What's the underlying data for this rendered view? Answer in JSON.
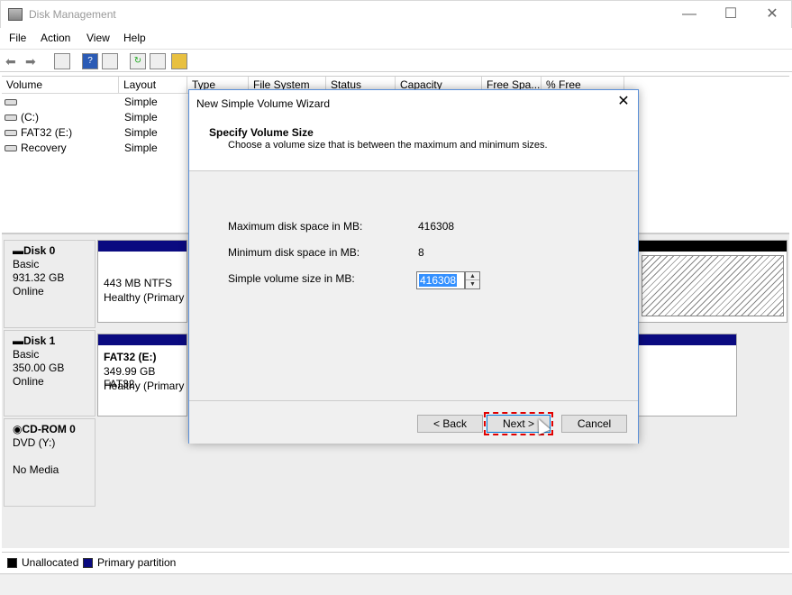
{
  "window": {
    "title": "Disk Management",
    "minimize": "—",
    "maximize": "☐",
    "close": "✕"
  },
  "menu": [
    "File",
    "Action",
    "View",
    "Help"
  ],
  "volume_list": {
    "columns": [
      "Volume",
      "Layout",
      "Type",
      "File System",
      "Status",
      "Capacity",
      "Free Spa...",
      "% Free"
    ],
    "rows": [
      {
        "volume": "",
        "layout": "Simple"
      },
      {
        "volume": "(C:)",
        "layout": "Simple"
      },
      {
        "volume": "FAT32 (E:)",
        "layout": "Simple"
      },
      {
        "volume": "Recovery",
        "layout": "Simple"
      }
    ]
  },
  "disks": [
    {
      "name": "Disk 0",
      "type": "Basic",
      "size": "931.32 GB",
      "status": "Online",
      "partition_line1": "443 MB NTFS",
      "partition_line2": "Healthy (Primary P"
    },
    {
      "name": "Disk 1",
      "type": "Basic",
      "size": "350.00 GB",
      "status": "Online",
      "partition_title": "FAT32  (E:)",
      "partition_line1": "349.99 GB FAT32",
      "partition_line2": "Healthy (Primary P"
    },
    {
      "name": "CD-ROM 0",
      "type": "DVD (Y:)",
      "status": "No Media"
    }
  ],
  "legend": {
    "unallocated": "Unallocated",
    "primary": "Primary partition",
    "unallocated_color": "#000000",
    "primary_color": "#0a0a80"
  },
  "dialog": {
    "title": "New Simple Volume Wizard",
    "close": "✕",
    "heading": "Specify Volume Size",
    "subheading": "Choose a volume size that is between the maximum and minimum sizes.",
    "max_label": "Maximum disk space in MB:",
    "max_value": "416308",
    "min_label": "Minimum disk space in MB:",
    "min_value": "8",
    "size_label": "Simple volume size in MB:",
    "size_value": "416308",
    "back": "< Back",
    "next": "Next >",
    "cancel": "Cancel"
  }
}
